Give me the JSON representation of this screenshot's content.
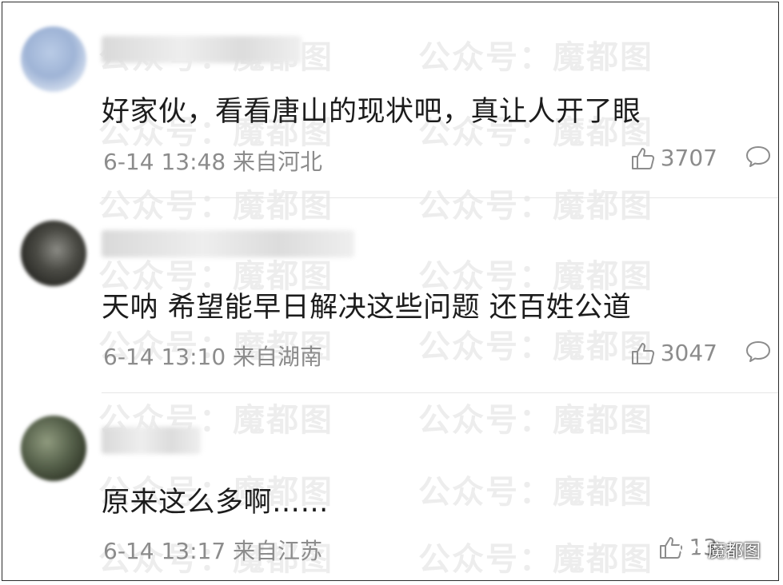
{
  "watermark_text": "公众号：魔都图",
  "comments": [
    {
      "text": "好家伙，看看唐山的现状吧，真让人开了眼",
      "time": "6-14 13:48",
      "location": "来自河北",
      "likes": "3707"
    },
    {
      "text": "天呐 希望能早日解决这些问题 还百姓公道",
      "time": "6-14 13:10",
      "location": "来自湖南",
      "likes": "3047"
    },
    {
      "text": "原来这么多啊……",
      "time": "6-14 13:17",
      "location": "来自江苏",
      "likes": "13"
    }
  ],
  "badge": {
    "label": "魔都图"
  },
  "colors": {
    "text": "#1c1c1c",
    "meta": "#8c8c8c",
    "divider": "#e6e6e6"
  }
}
